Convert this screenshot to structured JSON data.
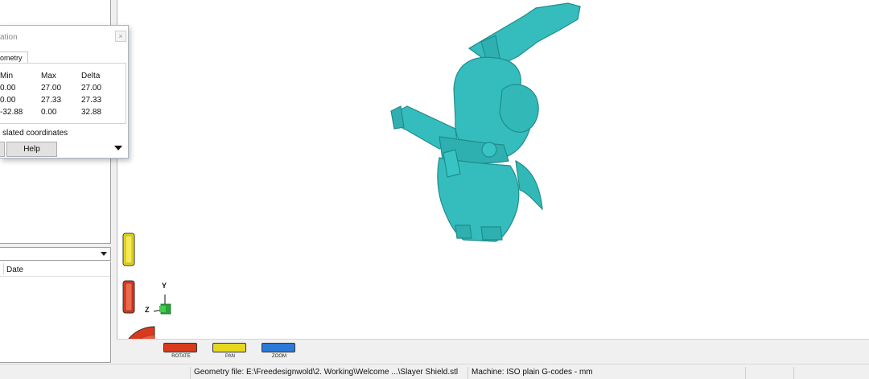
{
  "left_panel": {
    "list_header_date": "Date"
  },
  "dialog": {
    "title": "ation",
    "tab_label": "ometry",
    "columns": [
      "Min",
      "Max",
      "Delta"
    ],
    "rows": [
      [
        "0.00",
        "27.00",
        "27.00"
      ],
      [
        "0.00",
        "27.33",
        "27.33"
      ],
      [
        "-32.88",
        "0.00",
        "32.88"
      ]
    ],
    "note": "slated coordinates",
    "help_label": "Help",
    "close_label": "×"
  },
  "toolbar": {
    "rotate_label": "ROTATE",
    "pan_label": "PAN",
    "zoom_label": "ZOOM"
  },
  "axes": {
    "y_label": "Y",
    "z_label": "Z"
  },
  "statusbar": {
    "geometry_file": "Geometry file: E:\\Freedesignwold\\2. Working\\Welcome ...\\Slayer Shield.stl",
    "machine": "Machine: ISO plain G-codes - mm"
  },
  "colors": {
    "model": "#35bdbd",
    "model_shadow": "#1f8c8c",
    "rotate": "#d83a1e",
    "pan": "#e8d81c",
    "zoom": "#2a7ad8"
  }
}
